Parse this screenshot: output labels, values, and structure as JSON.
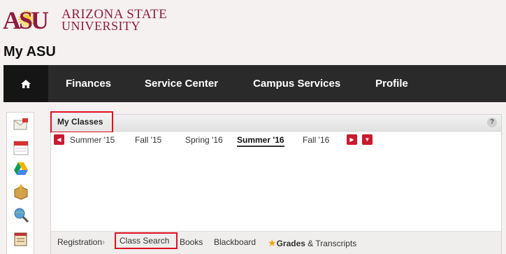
{
  "header": {
    "logo_mark": "ASU",
    "logo_line1": "Arizona State",
    "logo_line2": "University",
    "page_title": "My ASU"
  },
  "nav": {
    "home_icon": "home-icon",
    "items": [
      "Finances",
      "Service Center",
      "Campus Services",
      "Profile"
    ]
  },
  "rail": {
    "icons": [
      "email-icon",
      "calendar-icon",
      "google-drive-icon",
      "package-icon",
      "search-globe-icon",
      "course-catalog-icon"
    ]
  },
  "widget": {
    "title": "My Classes",
    "help": "?",
    "prev_icon": "◀",
    "next_icon": "▶",
    "dropdown_icon": "▼",
    "terms": [
      "Summer '15",
      "Fall '15",
      "Spring '16",
      "Summer '16",
      "Fall '16"
    ],
    "active_term": "Summer '16",
    "footer_links": {
      "registration": "Registration",
      "registration_chevron": "›",
      "class_search": "Class Search",
      "books": "Books",
      "blackboard": "Blackboard",
      "grades_bold": "Grades",
      "transcripts": " & Transcripts"
    }
  },
  "colors": {
    "brand_maroon": "#8c1d40",
    "brand_gold": "#ffc627",
    "nav_bg": "#2b2a2a",
    "highlight_red": "#e0101f"
  }
}
